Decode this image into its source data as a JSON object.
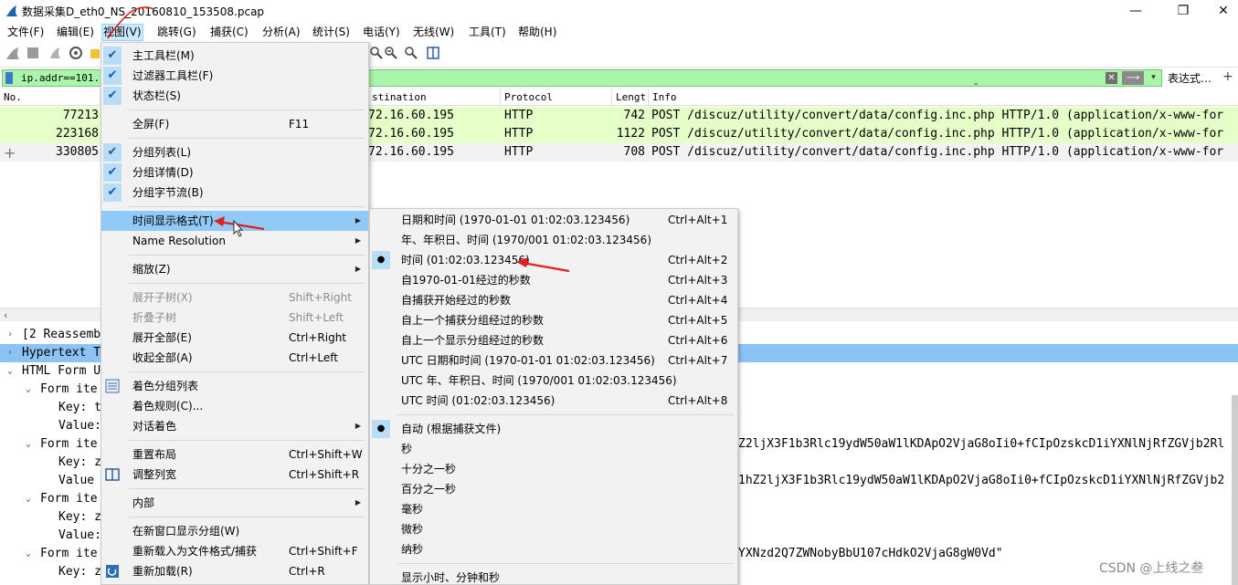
{
  "window": {
    "title": "数据采集D_eth0_NS_20160810_153508.pcap",
    "minimize": "—",
    "maximize": "❐",
    "close": "✕"
  },
  "menubar": [
    "文件(F)",
    "编辑(E)",
    "视图(V)",
    "跳转(G)",
    "捕获(C)",
    "分析(A)",
    "统计(S)",
    "电话(Y)",
    "无线(W)",
    "工具(T)",
    "帮助(H)"
  ],
  "filter": {
    "value": "ip.addr==101.3",
    "expression_label": "表达式…",
    "add_label": "+"
  },
  "packet_list": {
    "columns": [
      "No.",
      "",
      "",
      "stination",
      "Protocol",
      "Lengt",
      "Info"
    ],
    "rows": [
      {
        "no": "77213",
        "dest": "72.16.60.195",
        "proto": "HTTP",
        "len": "742",
        "info": "POST /discuz/utility/convert/data/config.inc.php HTTP/1.0  (application/x-www-for",
        "color": "#e4ffc7"
      },
      {
        "no": "223168",
        "dest": "72.16.60.195",
        "proto": "HTTP",
        "len": "1122",
        "info": "POST /discuz/utility/convert/data/config.inc.php HTTP/1.0  (application/x-www-for",
        "color": "#e4ffc7"
      },
      {
        "no": "330805",
        "dest": "72.16.60.195",
        "proto": "HTTP",
        "len": "708",
        "info": "POST /discuz/utility/convert/data/config.inc.php HTTP/1.0  (application/x-www-for",
        "color": "#f2f2f2"
      }
    ]
  },
  "details": {
    "rows": [
      {
        "twisty": "›",
        "indent": 0,
        "text": "[2 Reassemb"
      },
      {
        "twisty": "›",
        "indent": 0,
        "text": "Hypertext T",
        "selected": true
      },
      {
        "twisty": "⌄",
        "indent": 0,
        "text": "HTML Form U"
      },
      {
        "twisty": "⌄",
        "indent": 1,
        "text": "Form ite"
      },
      {
        "twisty": "",
        "indent": 2,
        "text": "Key: t"
      },
      {
        "twisty": "",
        "indent": 2,
        "text": "Value:"
      },
      {
        "twisty": "⌄",
        "indent": 1,
        "text": "Form ite"
      },
      {
        "twisty": "",
        "indent": 2,
        "text": "Key: z"
      },
      {
        "twisty": "",
        "indent": 2,
        "text": "Value"
      },
      {
        "twisty": "⌄",
        "indent": 1,
        "text": "Form ite"
      },
      {
        "twisty": "",
        "indent": 2,
        "text": "Key: z"
      },
      {
        "twisty": "",
        "indent": 2,
        "text": "Value:"
      },
      {
        "twisty": "⌄",
        "indent": 1,
        "text": "Form ite"
      },
      {
        "twisty": "",
        "indent": 2,
        "text": "Key: z"
      }
    ],
    "right_fragments": [
      "Z2ljX3F1b3Rlc19ydW50aW1lKDApO2VjaG8oIi0+fCIpOzskcD1iYXNlNjRfZGVjb2Rl",
      "1hZ2ljX3F1b3Rlc19ydW50aW1lKDApO2VjaG8oIi0+fCIpOzskcD1iYXNlNjRfZGVjb2",
      "YXNzd2Q7ZWNobyBbU107cHdkO2VjaG8gW0Vd\""
    ]
  },
  "view_menu": {
    "items": [
      {
        "label": "主工具栏(M)",
        "shortcut": "",
        "checked": true
      },
      {
        "label": "过滤器工具栏(F)",
        "shortcut": "",
        "checked": true
      },
      {
        "label": "状态栏(S)",
        "shortcut": "",
        "checked": true
      },
      {
        "sep": true
      },
      {
        "label": "全屏(F)",
        "shortcut": "F11"
      },
      {
        "sep": true
      },
      {
        "label": "分组列表(L)",
        "shortcut": "",
        "checked": true
      },
      {
        "label": "分组详情(D)",
        "shortcut": "",
        "checked": true
      },
      {
        "label": "分组字节流(B)",
        "shortcut": "",
        "checked": true
      },
      {
        "sep": true
      },
      {
        "label": "时间显示格式(T)",
        "shortcut": "",
        "submenu": true,
        "highlighted": true
      },
      {
        "label": "Name Resolution",
        "shortcut": "",
        "submenu": true
      },
      {
        "sep": true
      },
      {
        "label": "缩放(Z)",
        "shortcut": "",
        "submenu": true
      },
      {
        "sep": true
      },
      {
        "label": "展开子树(X)",
        "shortcut": "Shift+Right",
        "disabled": true
      },
      {
        "label": "折叠子树",
        "shortcut": "Shift+Left",
        "disabled": true
      },
      {
        "label": "展开全部(E)",
        "shortcut": "Ctrl+Right"
      },
      {
        "label": "收起全部(A)",
        "shortcut": "Ctrl+Left"
      },
      {
        "sep": true
      },
      {
        "label": "着色分组列表",
        "shortcut": "",
        "icon": "colorize-icon"
      },
      {
        "label": "着色规则(C)...",
        "shortcut": ""
      },
      {
        "label": "对话着色",
        "shortcut": "",
        "submenu": true
      },
      {
        "sep": true
      },
      {
        "label": "重置布局",
        "shortcut": "Ctrl+Shift+W"
      },
      {
        "label": "调整列宽",
        "shortcut": "Ctrl+Shift+R",
        "icon": "resize-columns-icon"
      },
      {
        "sep": true
      },
      {
        "label": "内部",
        "shortcut": "",
        "submenu": true
      },
      {
        "sep": true
      },
      {
        "label": "在新窗口显示分组(W)",
        "shortcut": ""
      },
      {
        "label": "重新载入为文件格式/捕获",
        "shortcut": "Ctrl+Shift+F"
      },
      {
        "label": "重新加载(R)",
        "shortcut": "Ctrl+R",
        "icon": "reload-icon"
      }
    ]
  },
  "time_menu": {
    "items": [
      {
        "label": "日期和时间 (1970-01-01 01:02:03.123456)",
        "shortcut": "Ctrl+Alt+1"
      },
      {
        "label": "年、年积日、时间 (1970/001 01:02:03.123456)",
        "shortcut": ""
      },
      {
        "label": "时间 (01:02:03.123456)",
        "shortcut": "Ctrl+Alt+2",
        "radio": true
      },
      {
        "label": "自1970-01-01经过的秒数",
        "shortcut": "Ctrl+Alt+3"
      },
      {
        "label": "自捕获开始经过的秒数",
        "shortcut": "Ctrl+Alt+4"
      },
      {
        "label": "自上一个捕获分组经过的秒数",
        "shortcut": "Ctrl+Alt+5"
      },
      {
        "label": "自上一个显示分组经过的秒数",
        "shortcut": "Ctrl+Alt+6"
      },
      {
        "label": "UTC 日期和时间 (1970-01-01 01:02:03.123456)",
        "shortcut": "Ctrl+Alt+7"
      },
      {
        "label": "UTC 年、年积日、时间 (1970/001 01:02:03.123456)",
        "shortcut": ""
      },
      {
        "label": "UTC 时间 (01:02:03.123456)",
        "shortcut": "Ctrl+Alt+8"
      },
      {
        "sep": true
      },
      {
        "label": "自动 (根据捕获文件)",
        "shortcut": "",
        "radio": true
      },
      {
        "label": "秒",
        "shortcut": ""
      },
      {
        "label": "十分之一秒",
        "shortcut": ""
      },
      {
        "label": "百分之一秒",
        "shortcut": ""
      },
      {
        "label": "毫秒",
        "shortcut": ""
      },
      {
        "label": "微秒",
        "shortcut": ""
      },
      {
        "label": "纳秒",
        "shortcut": ""
      },
      {
        "sep": true
      },
      {
        "label": "显示小时、分钟和秒",
        "shortcut": ""
      }
    ]
  },
  "watermark": "CSDN @上线之叁",
  "colors": {
    "filter_bg": "#a9f5a9",
    "menu_highlight": "#91c9f7",
    "selected_row": "#8cc3f5",
    "annotation_red": "#e02020"
  }
}
